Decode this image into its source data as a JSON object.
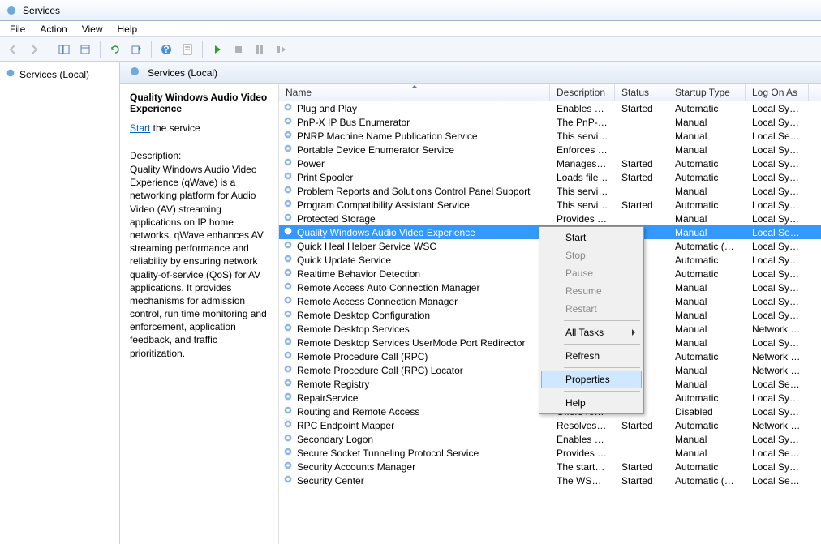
{
  "window": {
    "title": "Services"
  },
  "menubar": [
    "File",
    "Action",
    "View",
    "Help"
  ],
  "tree": {
    "root": "Services (Local)"
  },
  "pane": {
    "title": "Services (Local)"
  },
  "detail": {
    "name": "Quality Windows Audio Video Experience",
    "action_label": "Start",
    "action_suffix": " the service",
    "desc_label": "Description:",
    "desc_text": "Quality Windows Audio Video Experience (qWave) is a networking platform for Audio Video (AV) streaming applications on IP home networks. qWave enhances AV streaming performance and reliability by ensuring network quality-of-service (QoS) for AV applications. It provides mechanisms for admission control, run time monitoring and enforcement, application feedback, and traffic prioritization."
  },
  "columns": {
    "name": "Name",
    "desc": "Description",
    "status": "Status",
    "startup": "Startup Type",
    "logon": "Log On As"
  },
  "services": [
    {
      "name": "Plug and Play",
      "desc": "Enables a c...",
      "status": "Started",
      "startup": "Automatic",
      "logon": "Local Syste..."
    },
    {
      "name": "PnP-X IP Bus Enumerator",
      "desc": "The PnP-X ...",
      "status": "",
      "startup": "Manual",
      "logon": "Local Syste..."
    },
    {
      "name": "PNRP Machine Name Publication Service",
      "desc": "This service ...",
      "status": "",
      "startup": "Manual",
      "logon": "Local Service"
    },
    {
      "name": "Portable Device Enumerator Service",
      "desc": "Enforces gr...",
      "status": "",
      "startup": "Manual",
      "logon": "Local Syste..."
    },
    {
      "name": "Power",
      "desc": "Manages p...",
      "status": "Started",
      "startup": "Automatic",
      "logon": "Local Syste..."
    },
    {
      "name": "Print Spooler",
      "desc": "Loads files t...",
      "status": "Started",
      "startup": "Automatic",
      "logon": "Local Syste..."
    },
    {
      "name": "Problem Reports and Solutions Control Panel Support",
      "desc": "This service ...",
      "status": "",
      "startup": "Manual",
      "logon": "Local Syste..."
    },
    {
      "name": "Program Compatibility Assistant Service",
      "desc": "This service ...",
      "status": "Started",
      "startup": "Automatic",
      "logon": "Local Syste..."
    },
    {
      "name": "Protected Storage",
      "desc": "Provides pr...",
      "status": "",
      "startup": "Manual",
      "logon": "Local Syste..."
    },
    {
      "name": "Quality Windows Audio Video Experience",
      "desc": "",
      "status": "",
      "startup": "Manual",
      "logon": "Local Service",
      "selected": true
    },
    {
      "name": "Quick Heal Helper Service WSC",
      "desc": "",
      "status": "ed",
      "startup": "Automatic (D...",
      "logon": "Local Syste..."
    },
    {
      "name": "Quick Update Service",
      "desc": "",
      "status": "ed",
      "startup": "Automatic",
      "logon": "Local Syste..."
    },
    {
      "name": "Realtime Behavior Detection",
      "desc": "",
      "status": "ed",
      "startup": "Automatic",
      "logon": "Local Syste..."
    },
    {
      "name": "Remote Access Auto Connection Manager",
      "desc": "",
      "status": "",
      "startup": "Manual",
      "logon": "Local Syste..."
    },
    {
      "name": "Remote Access Connection Manager",
      "desc": "",
      "status": "",
      "startup": "Manual",
      "logon": "Local Syste..."
    },
    {
      "name": "Remote Desktop Configuration",
      "desc": "",
      "status": "",
      "startup": "Manual",
      "logon": "Local Syste..."
    },
    {
      "name": "Remote Desktop Services",
      "desc": "",
      "status": "",
      "startup": "Manual",
      "logon": "Network S..."
    },
    {
      "name": "Remote Desktop Services UserMode Port Redirector",
      "desc": "",
      "status": "",
      "startup": "Manual",
      "logon": "Local Syste..."
    },
    {
      "name": "Remote Procedure Call (RPC)",
      "desc": "",
      "status": "ed",
      "startup": "Automatic",
      "logon": "Network S..."
    },
    {
      "name": "Remote Procedure Call (RPC) Locator",
      "desc": "",
      "status": "",
      "startup": "Manual",
      "logon": "Network S..."
    },
    {
      "name": "Remote Registry",
      "desc": "",
      "status": "",
      "startup": "Manual",
      "logon": "Local Service"
    },
    {
      "name": "RepairService",
      "desc": "",
      "status": "ed",
      "startup": "Automatic",
      "logon": "Local Syste..."
    },
    {
      "name": "Routing and Remote Access",
      "desc": "Offers routi...",
      "status": "",
      "startup": "Disabled",
      "logon": "Local Syste..."
    },
    {
      "name": "RPC Endpoint Mapper",
      "desc": "Resolves RP...",
      "status": "Started",
      "startup": "Automatic",
      "logon": "Network S..."
    },
    {
      "name": "Secondary Logon",
      "desc": "Enables star...",
      "status": "",
      "startup": "Manual",
      "logon": "Local Syste..."
    },
    {
      "name": "Secure Socket Tunneling Protocol Service",
      "desc": "Provides su...",
      "status": "",
      "startup": "Manual",
      "logon": "Local Service"
    },
    {
      "name": "Security Accounts Manager",
      "desc": "The startup ...",
      "status": "Started",
      "startup": "Automatic",
      "logon": "Local Syste..."
    },
    {
      "name": "Security Center",
      "desc": "The WSCSV...",
      "status": "Started",
      "startup": "Automatic (D...",
      "logon": "Local Service"
    }
  ],
  "context_menu": {
    "items": [
      {
        "label": "Start",
        "enabled": true
      },
      {
        "label": "Stop",
        "enabled": false
      },
      {
        "label": "Pause",
        "enabled": false
      },
      {
        "label": "Resume",
        "enabled": false
      },
      {
        "label": "Restart",
        "enabled": false
      },
      {
        "sep": true
      },
      {
        "label": "All Tasks",
        "enabled": true,
        "submenu": true
      },
      {
        "sep": true
      },
      {
        "label": "Refresh",
        "enabled": true
      },
      {
        "sep": true
      },
      {
        "label": "Properties",
        "enabled": true,
        "highlight": true
      },
      {
        "sep": true
      },
      {
        "label": "Help",
        "enabled": true
      }
    ]
  }
}
